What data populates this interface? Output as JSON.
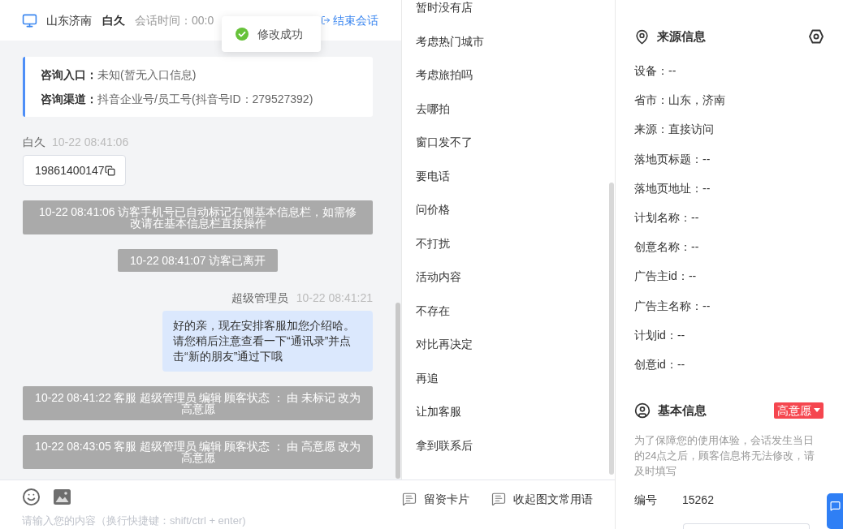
{
  "header": {
    "location": "山东济南",
    "visitor": "白久",
    "session_time": "会话时间：00:0",
    "end_button": "结束会话"
  },
  "toast": {
    "kind": "success",
    "message": "修改成功"
  },
  "entry_card": {
    "rows": [
      {
        "label": "咨询入口：",
        "value": "未知(暂无入口信息)"
      },
      {
        "label": "咨询渠道：",
        "value": "抖音企业号/员工号(抖音号ID：279527392)"
      }
    ]
  },
  "messages": [
    {
      "kind": "visitor",
      "sender": "白久",
      "time": "10-22 08:41:06",
      "text": "19861400147"
    },
    {
      "kind": "system",
      "text": "10-22 08:41:06 访客手机号已自动标记右侧基本信息栏，如需修改请在基本信息栏直接操作"
    },
    {
      "kind": "system",
      "text": "10-22 08:41:07 访客已离开"
    },
    {
      "kind": "agent",
      "sender": "超级管理员",
      "time": "10-22 08:41:21",
      "text": "好的亲，现在安排客服加您介绍哈。请您稍后注意查看一下“通讯录”并点击“新的朋友”通过下哦"
    },
    {
      "kind": "system",
      "text": "10-22 08:41:22 客服 超级管理员 编辑 顾客状态 ： 由 未标记 改为高意愿"
    },
    {
      "kind": "system",
      "text": "10-22 08:43:05 客服 超级管理员 编辑 顾客状态 ： 由 高意愿 改为高意愿"
    }
  ],
  "quick_replies": [
    "暂时没有店",
    "考虑热门城市",
    "考虑旅拍吗",
    "去哪拍",
    "窗口发不了",
    "要电话",
    "问价格",
    "不打扰",
    "活动内容",
    "不存在",
    "对比再决定",
    "再追",
    "让加客服",
    "拿到联系后"
  ],
  "toolbar": {
    "buttons": [
      "留资卡片",
      "收起图文常用语"
    ]
  },
  "composer": {
    "placeholder": "请输入您的内容（换行快捷键：shift/ctrl + enter)"
  },
  "source_info": {
    "title": "来源信息",
    "rows": [
      "设备：--",
      "省市：山东，济南",
      "来源：直接访问",
      "落地页标题：--",
      "落地页地址：--",
      "计划名称：--",
      "创意名称：--",
      "广告主id：--",
      "广告主名称：--",
      "计划id：--",
      "创意id：--"
    ]
  },
  "basic_info": {
    "title": "基本信息",
    "status": "高意愿",
    "note": "为了保障您的使用体验，会话发生当日的24点之后，顾客信息将无法修改，请及时填写",
    "fields": [
      {
        "label": "编号",
        "value": "15262"
      }
    ]
  }
}
